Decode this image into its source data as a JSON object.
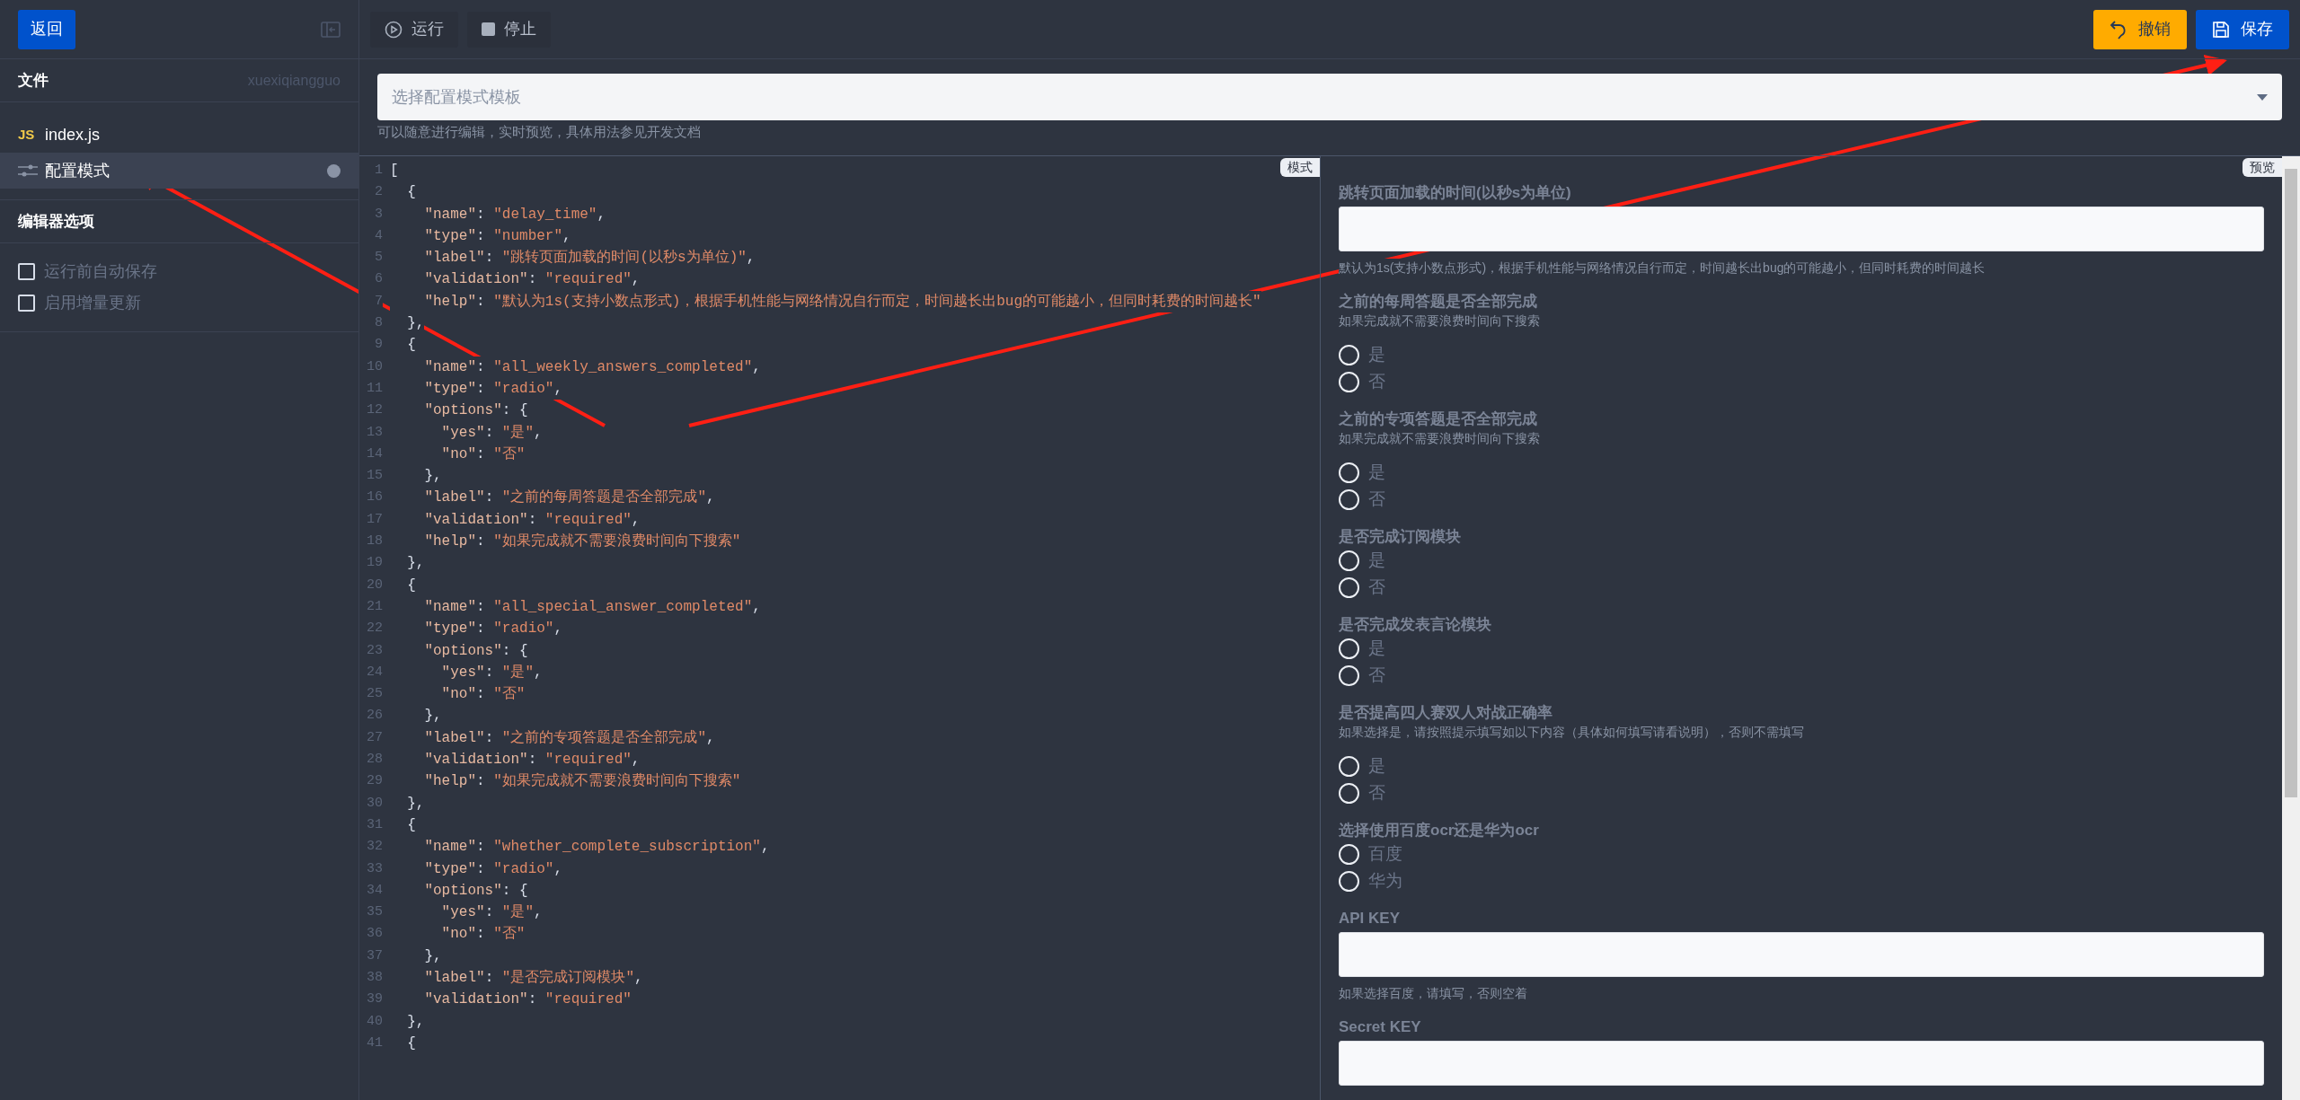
{
  "sidebar": {
    "back_button": "返回",
    "files_heading": "文件",
    "project_name": "xuexiqiangguo",
    "files": [
      {
        "kind": "js",
        "badge": "JS",
        "name": "index.js",
        "selected": false
      },
      {
        "kind": "config",
        "name": "配置模式",
        "selected": true
      }
    ],
    "options_heading": "编辑器选项",
    "options": [
      {
        "label": "运行前自动保存",
        "checked": false
      },
      {
        "label": "启用增量更新",
        "checked": false
      }
    ]
  },
  "toolbar": {
    "run": "运行",
    "stop": "停止",
    "undo": "撤销",
    "save": "保存"
  },
  "template_select": {
    "placeholder": "选择配置模式模板",
    "help": "可以随意进行编辑，实时预览，具体用法参见开发文档"
  },
  "editor": {
    "tag": "模式",
    "lines": [
      {
        "number": "1",
        "text": "["
      },
      {
        "number": "2",
        "text": "  {"
      },
      {
        "number": "3",
        "text": "    \"name\": \"delay_time\","
      },
      {
        "number": "4",
        "text": "    \"type\": \"number\","
      },
      {
        "number": "5",
        "text": "    \"label\": \"跳转页面加载的时间(以秒s为单位)\","
      },
      {
        "number": "6",
        "text": "    \"validation\": \"required\","
      },
      {
        "number": "7",
        "text": "    \"help\": \"默认为1s(支持小数点形式)，根据手机性能与网络情况自行而定，时间越长出bug的可能越小，但同时耗费的时间越长\""
      },
      {
        "number": "8",
        "text": "  },"
      },
      {
        "number": "9",
        "text": "  {"
      },
      {
        "number": "10",
        "text": "    \"name\": \"all_weekly_answers_completed\","
      },
      {
        "number": "11",
        "text": "    \"type\": \"radio\","
      },
      {
        "number": "12",
        "text": "    \"options\": {"
      },
      {
        "number": "13",
        "text": "      \"yes\": \"是\","
      },
      {
        "number": "14",
        "text": "      \"no\": \"否\""
      },
      {
        "number": "15",
        "text": "    },"
      },
      {
        "number": "16",
        "text": "    \"label\": \"之前的每周答题是否全部完成\","
      },
      {
        "number": "17",
        "text": "    \"validation\": \"required\","
      },
      {
        "number": "18",
        "text": "    \"help\": \"如果完成就不需要浪费时间向下搜索\""
      },
      {
        "number": "19",
        "text": "  },"
      },
      {
        "number": "20",
        "text": "  {"
      },
      {
        "number": "21",
        "text": "    \"name\": \"all_special_answer_completed\","
      },
      {
        "number": "22",
        "text": "    \"type\": \"radio\","
      },
      {
        "number": "23",
        "text": "    \"options\": {"
      },
      {
        "number": "24",
        "text": "      \"yes\": \"是\","
      },
      {
        "number": "25",
        "text": "      \"no\": \"否\""
      },
      {
        "number": "26",
        "text": "    },"
      },
      {
        "number": "27",
        "text": "    \"label\": \"之前的专项答题是否全部完成\","
      },
      {
        "number": "28",
        "text": "    \"validation\": \"required\","
      },
      {
        "number": "29",
        "text": "    \"help\": \"如果完成就不需要浪费时间向下搜索\""
      },
      {
        "number": "30",
        "text": "  },"
      },
      {
        "number": "31",
        "text": "  {"
      },
      {
        "number": "32",
        "text": "    \"name\": \"whether_complete_subscription\","
      },
      {
        "number": "33",
        "text": "    \"type\": \"radio\","
      },
      {
        "number": "34",
        "text": "    \"options\": {"
      },
      {
        "number": "35",
        "text": "      \"yes\": \"是\","
      },
      {
        "number": "36",
        "text": "      \"no\": \"否\""
      },
      {
        "number": "37",
        "text": "    },"
      },
      {
        "number": "38",
        "text": "    \"label\": \"是否完成订阅模块\","
      },
      {
        "number": "39",
        "text": "    \"validation\": \"required\""
      },
      {
        "number": "40",
        "text": "  },"
      },
      {
        "number": "41",
        "text": "  {"
      }
    ]
  },
  "preview": {
    "tag": "预览",
    "fields": [
      {
        "kind": "input",
        "label": "跳转页面加载的时间(以秒s为单位)",
        "help": "默认为1s(支持小数点形式)，根据手机性能与网络情况自行而定，时间越长出bug的可能越小，但同时耗费的时间越长"
      },
      {
        "kind": "radio",
        "label": "之前的每周答题是否全部完成",
        "help": "如果完成就不需要浪费时间向下搜索",
        "options": [
          {
            "label": "是",
            "selected": false
          },
          {
            "label": "否",
            "selected": false
          }
        ]
      },
      {
        "kind": "radio",
        "label": "之前的专项答题是否全部完成",
        "help": "如果完成就不需要浪费时间向下搜索",
        "options": [
          {
            "label": "是",
            "selected": false
          },
          {
            "label": "否",
            "selected": false
          }
        ]
      },
      {
        "kind": "radio",
        "label": "是否完成订阅模块",
        "options": [
          {
            "label": "是",
            "selected": false
          },
          {
            "label": "否",
            "selected": false
          }
        ]
      },
      {
        "kind": "radio",
        "label": "是否完成发表言论模块",
        "options": [
          {
            "label": "是",
            "selected": false
          },
          {
            "label": "否",
            "selected": false
          }
        ]
      },
      {
        "kind": "radio",
        "label": "是否提高四人赛双人对战正确率",
        "help": "如果选择是，请按照提示填写如以下内容（具体如何填写请看说明），否则不需填写",
        "options": [
          {
            "label": "是",
            "selected": false
          },
          {
            "label": "否",
            "selected": false
          }
        ]
      },
      {
        "kind": "radio",
        "label": "选择使用百度ocr还是华为ocr",
        "options": [
          {
            "label": "百度",
            "selected": false
          },
          {
            "label": "华为",
            "selected": false
          }
        ]
      },
      {
        "kind": "input",
        "label": "API KEY",
        "help": "如果选择百度，请填写，否则空着"
      },
      {
        "kind": "input",
        "label": "Secret KEY"
      }
    ]
  }
}
